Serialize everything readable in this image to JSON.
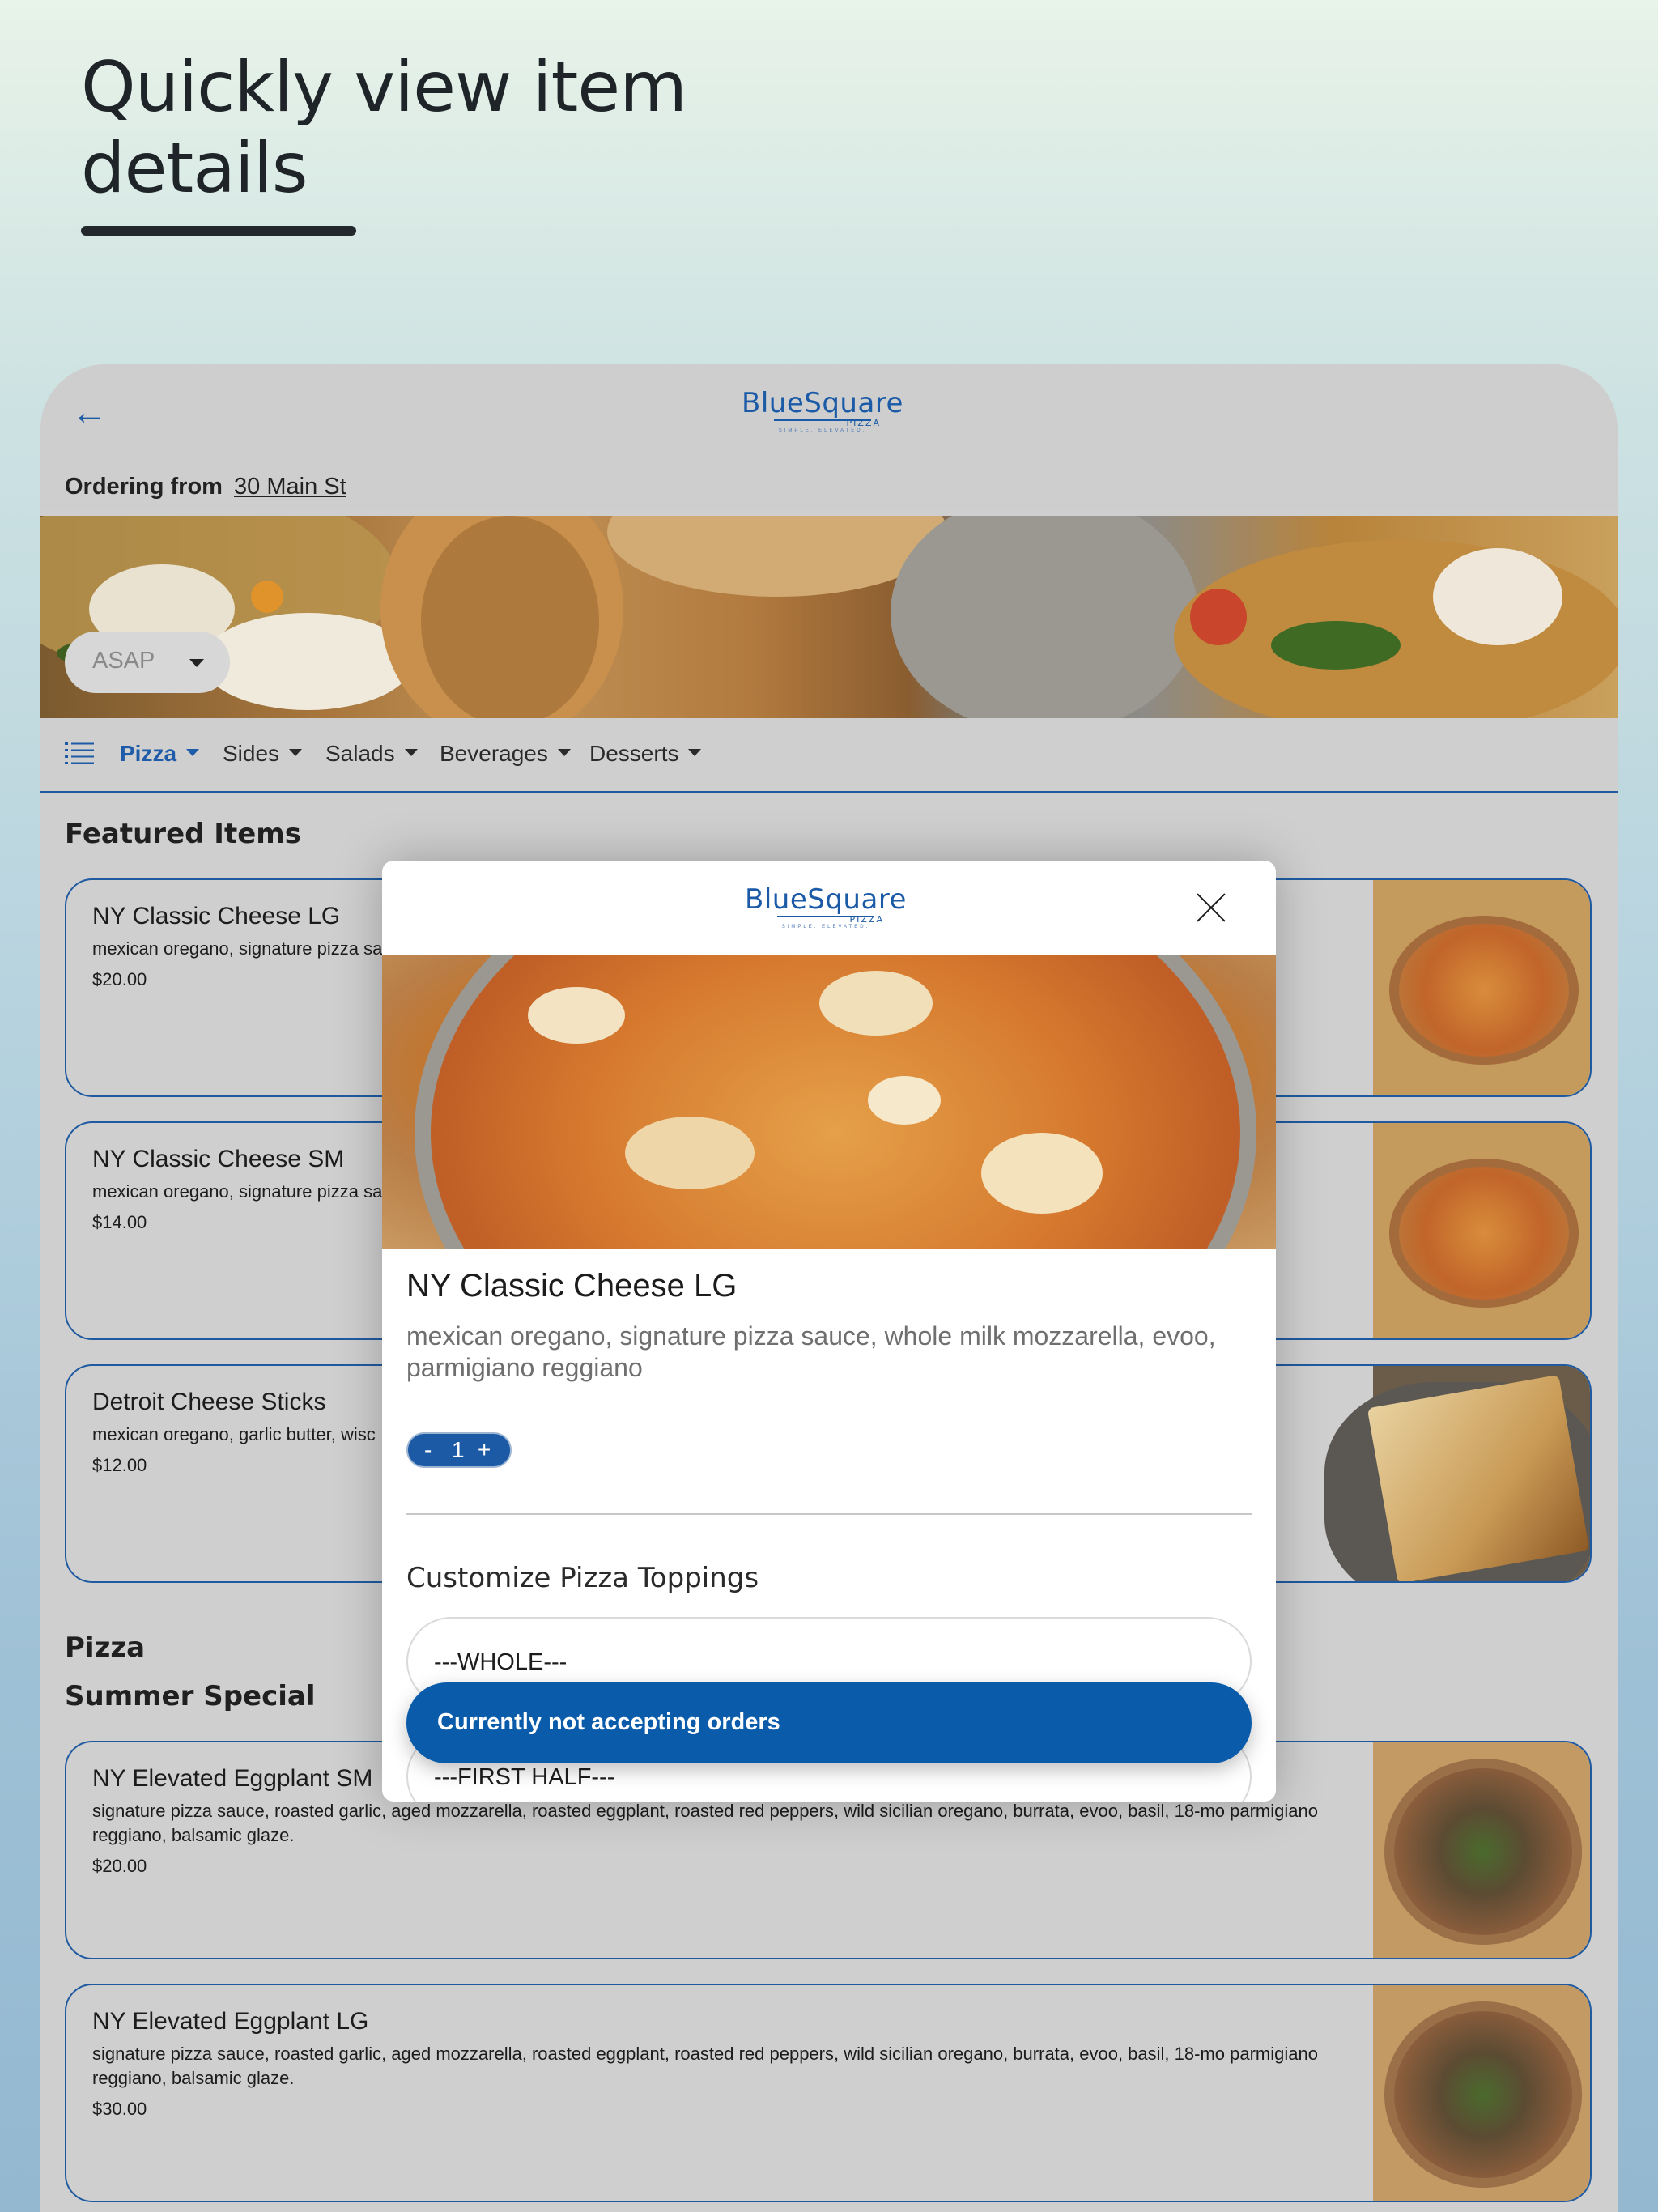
{
  "hero": {
    "title": "Quickly view item details"
  },
  "app": {
    "brand": {
      "name": "BlueSquare",
      "sub": "PIZZA",
      "tagline": "SIMPLE. ELEVATED."
    },
    "ordering_label": "Ordering from",
    "ordering_address": "30 Main St",
    "time_select": {
      "value": "ASAP"
    },
    "nav": {
      "items": [
        {
          "label": "Pizza",
          "active": true
        },
        {
          "label": "Sides"
        },
        {
          "label": "Salads"
        },
        {
          "label": "Beverages"
        },
        {
          "label": "Desserts"
        }
      ]
    },
    "sections": {
      "featured": "Featured Items",
      "pizza": "Pizza",
      "summer": "Summer Special"
    },
    "featured_items": [
      {
        "title": "NY Classic Cheese LG",
        "desc": "mexican oregano, signature pizza sa",
        "price": "$20.00"
      },
      {
        "title": "NY Classic Cheese SM",
        "desc": "mexican oregano, signature pizza sa",
        "price": "$14.00"
      },
      {
        "title": "Detroit Cheese Sticks",
        "desc": "mexican oregano, garlic butter, wisc",
        "price": "$12.00"
      }
    ],
    "summer_items": [
      {
        "title": "NY  Elevated Eggplant SM",
        "desc": "signature pizza sauce, roasted garlic, aged mozzarella, roasted eggplant, roasted red peppers, wild sicilian oregano, burrata, evoo, basil, 18-mo parmigiano reggiano, balsamic glaze.",
        "price": "$20.00"
      },
      {
        "title": "NY Elevated Eggplant LG",
        "desc": "signature pizza sauce, roasted garlic, aged mozzarella, roasted eggplant, roasted red peppers, wild sicilian oregano, burrata, evoo, basil, 18-mo parmigiano reggiano, balsamic glaze.",
        "price": "$30.00"
      }
    ]
  },
  "modal": {
    "title": "NY Classic Cheese LG",
    "description": "mexican oregano, signature pizza sauce, whole milk mozzarella, evoo, parmigiano reggiano",
    "quantity": {
      "minus": "-",
      "value": "1",
      "plus": "+"
    },
    "customize_heading": "Customize Pizza Toppings",
    "selects": [
      "---WHOLE---",
      "---FIRST HALF---"
    ],
    "cta_label": "Currently not accepting orders"
  },
  "colors": {
    "brand_blue": "#1a5aa6",
    "cta_blue": "#0a5cab",
    "card_border": "#1f5aa0"
  },
  "icons": [
    "back-arrow-icon",
    "menu-list-icon",
    "close-icon",
    "chevron-down-icon"
  ]
}
